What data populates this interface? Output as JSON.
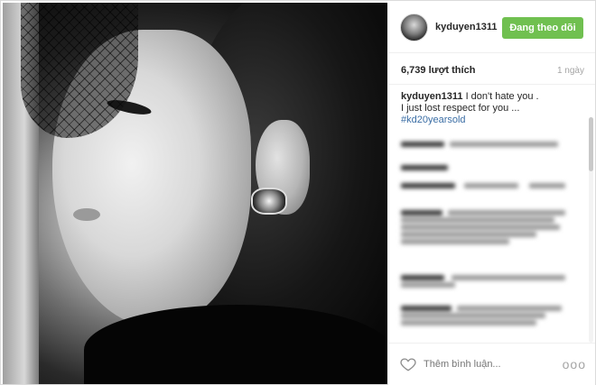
{
  "post": {
    "username": "kyduyen1311",
    "follow_label": "Đang theo dõi",
    "likes": "6,739 lượt thích",
    "time": "1 ngày",
    "caption": {
      "username": "kyduyen1311",
      "line1": "I don't hate you .",
      "line2": "I just lost respect for you ...",
      "hashtag": "#kd20yearsold"
    },
    "comment_placeholder": "Thêm bình luận...",
    "more_label": "ooo"
  },
  "colors": {
    "follow_green": "#70c050",
    "hashtag_blue": "#3b6ea5",
    "muted_text": "#a5a5a5"
  },
  "icons": {
    "like": "heart-outline-icon",
    "more": "ellipsis-icon",
    "avatar": "profile-avatar"
  }
}
